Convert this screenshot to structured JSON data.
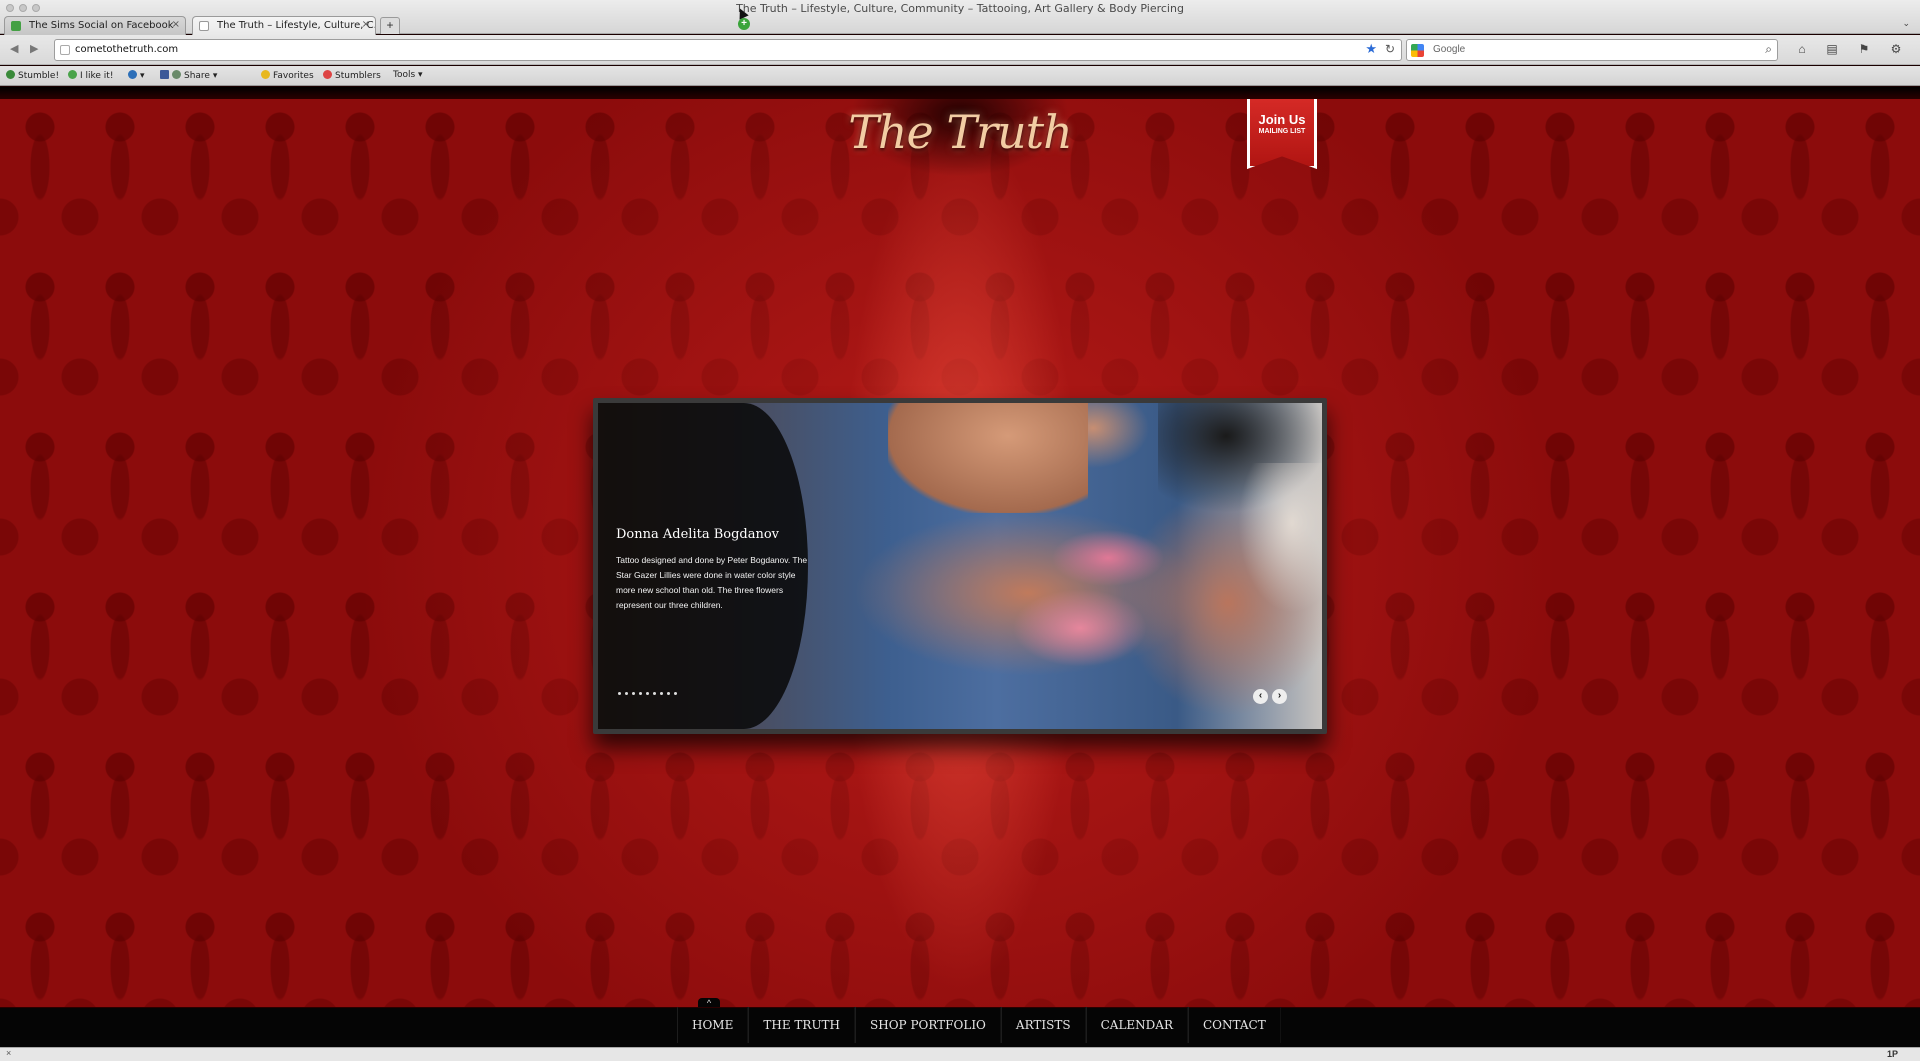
{
  "window": {
    "title": "The Truth – Lifestyle, Culture, Community – Tattooing, Art Gallery & Body Piercing"
  },
  "tabs": [
    {
      "label": "The Sims Social on Facebook",
      "icon": "sims-favicon",
      "color": "#44a044"
    },
    {
      "label": "The Truth – Lifestyle, Culture, C...",
      "icon": "blank-page-favicon"
    }
  ],
  "new_tab_label": "+",
  "address": {
    "url": "cometothetruth.com"
  },
  "search": {
    "placeholder": "Google"
  },
  "bookmarks": [
    {
      "label": "Stumble!",
      "icon": "stumbleupon-icon",
      "color": "#3a8a3a"
    },
    {
      "label": "I like it!",
      "icon": "thumbs-up-icon",
      "color": "#4aa34a"
    },
    {
      "label": "Share",
      "icon": "share-icon",
      "color": "#3b5998"
    },
    {
      "label": "Favorites",
      "icon": "star-icon",
      "color": "#e8b820"
    },
    {
      "label": "Stumblers",
      "icon": "people-icon",
      "color": "#d44"
    },
    {
      "label": "Tools",
      "icon": "tools-icon",
      "color": "#777"
    }
  ],
  "site": {
    "logo": "The Truth",
    "join": {
      "main": "Join Us",
      "sub": "MAILING LIST"
    },
    "accent": "#c91f1b"
  },
  "slide": {
    "title": "Donna Adelita Bogdanov",
    "body": "Tattoo designed and done by Peter Bogdanov. The Star Gazer Lillies were done in water color style more new school than old. The three flowers represent our three children.",
    "dot_count": 9,
    "prev": "‹",
    "next": "›"
  },
  "menu": [
    "HOME",
    "THE TRUTH",
    "SHOP PORTFOLIO",
    "ARTISTS",
    "CALENDAR",
    "CONTACT"
  ],
  "footer_toggle": "^",
  "status": {
    "left": "×",
    "right": "1P"
  }
}
